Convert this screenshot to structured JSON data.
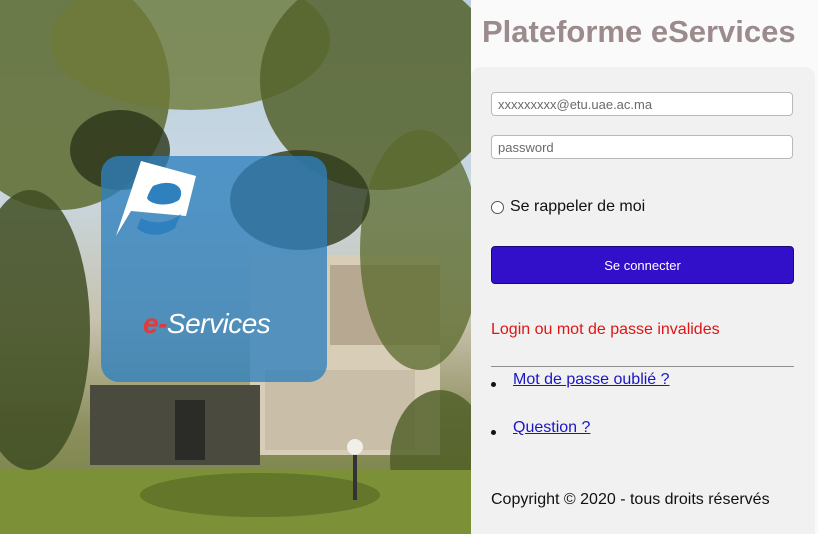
{
  "header": {
    "title": "Plateforme eServices"
  },
  "logo": {
    "prefix": "e-",
    "suffix": "Services"
  },
  "form": {
    "email_placeholder": "xxxxxxxxx@etu.uae.ac.ma",
    "password_placeholder": "password",
    "remember_label": "Se rappeler de moi",
    "remember_checked": false,
    "submit_label": "Se connecter"
  },
  "error_message": "Login ou mot de passe invalides",
  "links": [
    {
      "label": "Mot de passe oublié ?"
    },
    {
      "label": "Question ?"
    }
  ],
  "footer": {
    "copyright": "Copyright © 2020 - tous droits réservés"
  },
  "colors": {
    "title": "#9b8b8c",
    "button": "#3210c9",
    "error": "#e01515",
    "link": "#1a16c4",
    "logo_tile": "#2e80be"
  }
}
